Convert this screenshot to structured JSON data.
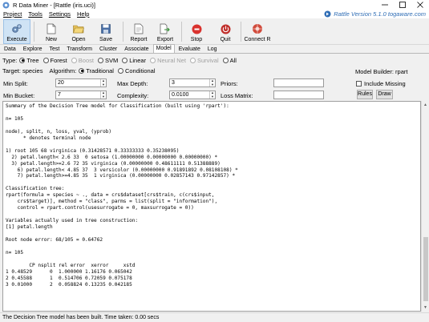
{
  "window": {
    "title": "R Data Miner - [Rattle (iris.uci)]",
    "controls": [
      "minimize",
      "maximize",
      "close"
    ]
  },
  "menu": {
    "items": [
      "Project",
      "Tools",
      "Settings",
      "Help"
    ],
    "version_text": "Rattle Version 5.1.0 togaware.com"
  },
  "toolbar": {
    "execute": "Execute",
    "new": "New",
    "open": "Open",
    "save": "Save",
    "report": "Report",
    "export": "Export",
    "stop": "Stop",
    "quit": "Quit",
    "connect": "Connect R"
  },
  "tabs": [
    "Data",
    "Explore",
    "Test",
    "Transform",
    "Cluster",
    "Associate",
    "Model",
    "Evaluate",
    "Log"
  ],
  "active_tab": "Model",
  "model": {
    "type_label": "Type:",
    "types": [
      {
        "label": "Tree",
        "selected": true,
        "enabled": true
      },
      {
        "label": "Forest",
        "selected": false,
        "enabled": true
      },
      {
        "label": "Boost",
        "selected": false,
        "enabled": false
      },
      {
        "label": "SVM",
        "selected": false,
        "enabled": true
      },
      {
        "label": "Linear",
        "selected": false,
        "enabled": true
      },
      {
        "label": "Neural Net",
        "selected": false,
        "enabled": false
      },
      {
        "label": "Survival",
        "selected": false,
        "enabled": false
      },
      {
        "label": "All",
        "selected": false,
        "enabled": true
      }
    ],
    "target_text": "Target: species",
    "algorithm_label": "Algorithm:",
    "algorithms": [
      {
        "label": "Traditional",
        "selected": true
      },
      {
        "label": "Conditional",
        "selected": false
      }
    ],
    "builder_text": "Model Builder:  rpart",
    "min_split_label": "Min Split:",
    "min_split_value": "20",
    "max_depth_label": "Max Depth:",
    "max_depth_value": "3",
    "priors_label": "Priors:",
    "priors_value": "",
    "include_missing_label": "Include Missing",
    "min_bucket_label": "Min Bucket:",
    "min_bucket_value": "7",
    "complexity_label": "Complexity:",
    "complexity_value": "0.0100",
    "loss_matrix_label": "Loss Matrix:",
    "loss_matrix_value": "",
    "rules_button": "Rules",
    "draw_button": "Draw"
  },
  "output_text": "Summary of the Decision Tree model for Classification (built using 'rpart'):\n\nn= 105\n\nnode), split, n, loss, yval, (yprob)\n      * denotes terminal node\n\n1) root 105 68 virginica (0.31428571 0.33333333 0.35238095)\n  2) petal.length< 2.6 33  0 setosa (1.00000000 0.00000000 0.00000000) *\n  3) petal.length>=2.6 72 35 virginica (0.00000000 0.48611111 0.51388889)\n    6) petal.length< 4.85 37  3 versicolor (0.00000000 0.91891892 0.08108108) *\n    7) petal.length>=4.85 35  1 virginica (0.00000000 0.02857143 0.97142857) *\n\nClassification tree:\nrpart(formula = species ~ ., data = crs$dataset[crs$train, c(crs$input,\n    crs$target)], method = \"class\", parms = list(split = \"information\"),\n    control = rpart.control(usesurrogate = 0, maxsurrogate = 0))\n\nVariables actually used in tree construction:\n[1] petal.length\n\nRoot node error: 68/105 = 0.64762\n\nn= 105\n\n        CP nsplit rel error  xerror     xstd\n1 0.48529      0  1.000000 1.16176 0.065042\n2 0.45588      1  0.514706 0.72059 0.075178\n3 0.01000      2  0.058824 0.13235 0.042185",
  "status": "The Decision Tree model has been built. Time taken: 0.00 secs"
}
